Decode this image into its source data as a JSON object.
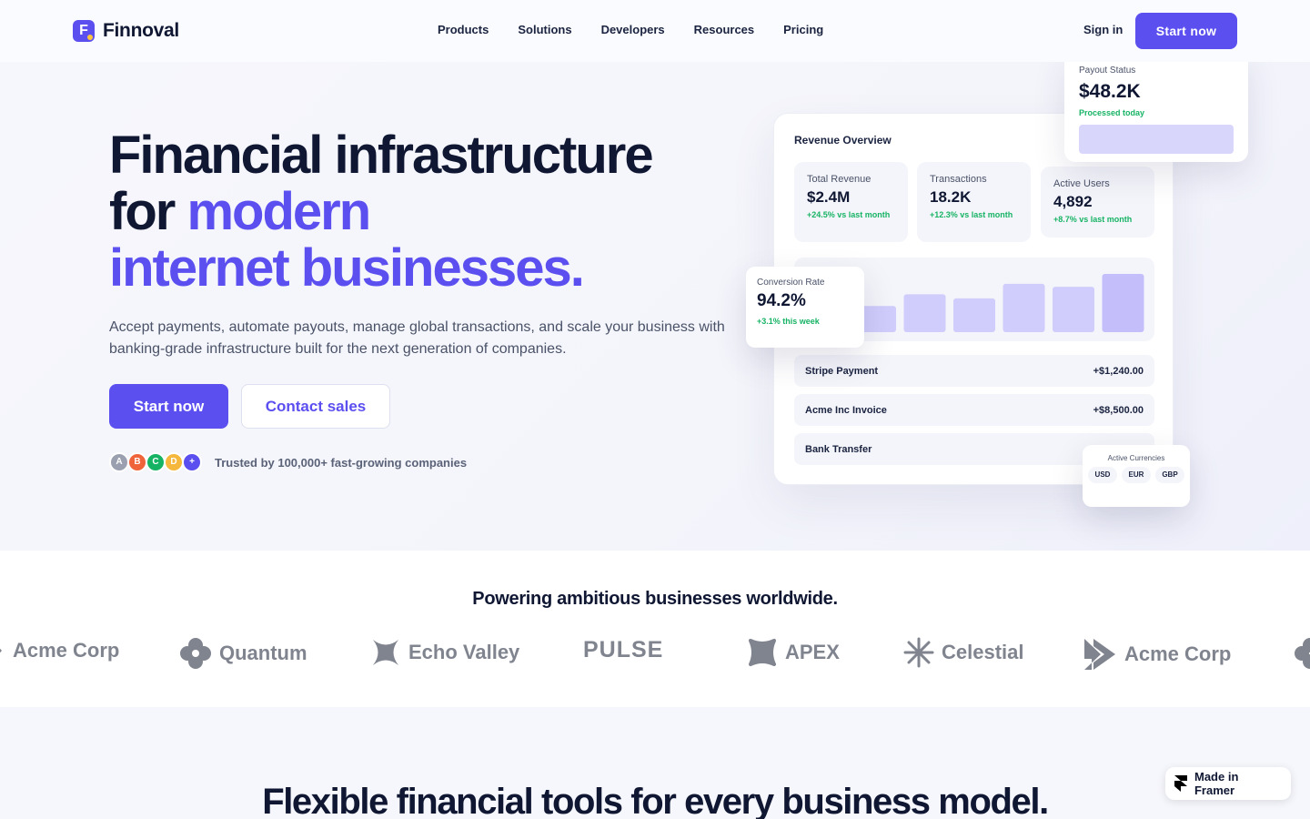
{
  "brand": {
    "name": "Finnoval",
    "mark": "F"
  },
  "nav": {
    "links": [
      "Products",
      "Solutions",
      "Developers",
      "Resources",
      "Pricing"
    ],
    "signin": "Sign in",
    "cta": "Start now"
  },
  "hero": {
    "title_line1": "Financial infrastructure",
    "title_line2_plain": "for ",
    "title_line2_accent": "modern",
    "title_line3_accent": "internet businesses.",
    "subtitle": "Accept payments, automate payouts, manage global transactions, and scale your business with banking-grade infrastructure built for the next generation of companies.",
    "primary_cta": "Start now",
    "secondary_cta": "Contact sales",
    "avatars": [
      "A",
      "B",
      "C",
      "D",
      "+"
    ],
    "trust_text": "Trusted by 100,000+ fast-growing companies"
  },
  "dashboard": {
    "title": "Revenue Overview",
    "stats": [
      {
        "label": "Total Revenue",
        "value": "$2.4M",
        "delta": "+24.5% vs last month"
      },
      {
        "label": "Transactions",
        "value": "18.2K",
        "delta": "+12.3% vs last month"
      },
      {
        "label": "Active Users",
        "value": "4,892",
        "delta": "+8.7% vs last month"
      }
    ],
    "bars": [
      0.45,
      0.65,
      0.58,
      0.83,
      0.78,
      1.0
    ],
    "transactions": [
      {
        "name": "Stripe Payment",
        "amount": "+$1,240.00"
      },
      {
        "name": "Acme Inc Invoice",
        "amount": "+$8,500.00"
      },
      {
        "name": "Bank Transfer",
        "amount": "+$"
      }
    ],
    "payout": {
      "label": "Payout Status",
      "value": "$48.2K",
      "note": "Processed today"
    },
    "conversion": {
      "label": "Conversion Rate",
      "value": "94.2%",
      "delta": "+3.1% this week"
    },
    "currencies": {
      "label": "Active Currencies",
      "codes": [
        "USD",
        "EUR",
        "GBP"
      ]
    }
  },
  "logos": {
    "title": "Powering ambitious businesses worldwide.",
    "items": [
      {
        "name": "Acme Corp",
        "icon": "acme-icon"
      },
      {
        "name": "Quantum",
        "icon": "clover-icon"
      },
      {
        "name": "Echo Valley",
        "icon": "x-cross-icon"
      },
      {
        "name": "PULSE",
        "icon": ""
      },
      {
        "name": "APEX",
        "icon": "blob-icon"
      },
      {
        "name": "Celestial",
        "icon": "star-burst-icon"
      },
      {
        "name": "Acme Corp",
        "icon": "chevron-logo-icon"
      }
    ]
  },
  "section2": {
    "title": "Flexible financial tools for every business model."
  },
  "framer_badge": "Made in Framer",
  "colors": {
    "accent": "#5b4ff0",
    "positive": "#16b364",
    "ink": "#0f1733"
  }
}
